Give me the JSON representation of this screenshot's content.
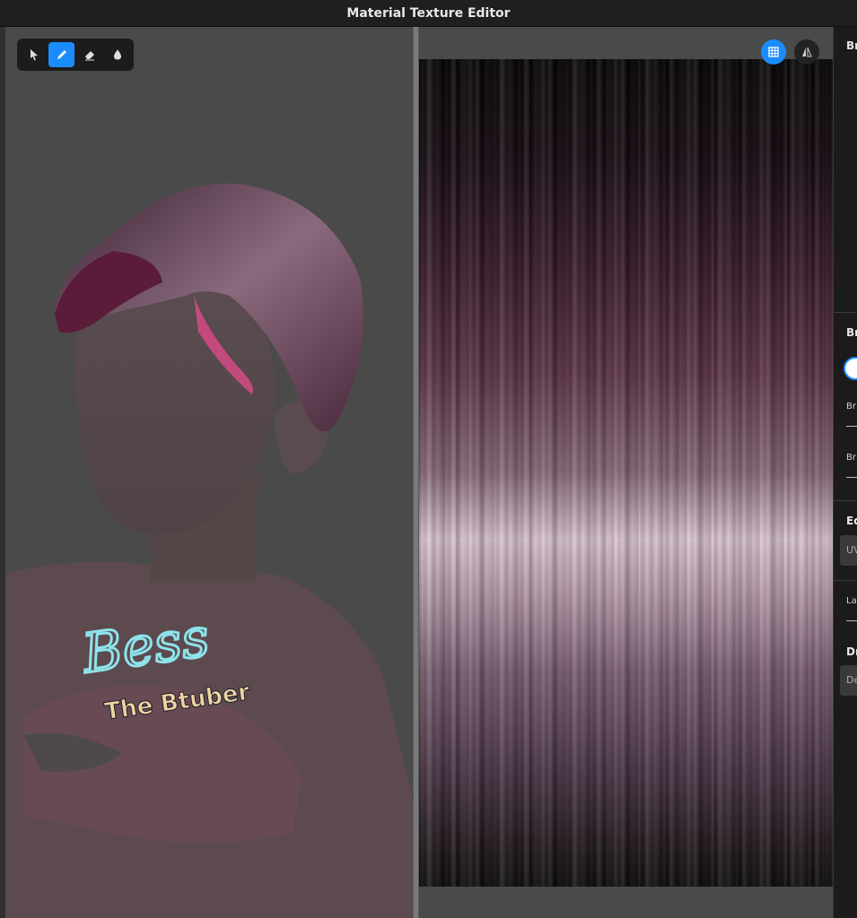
{
  "window": {
    "title": "Material Texture Editor"
  },
  "toolbar": {
    "tools": [
      {
        "name": "select",
        "icon": "cursor-arrow-icon",
        "active": false
      },
      {
        "name": "brush",
        "icon": "pencil-icon",
        "active": true
      },
      {
        "name": "eraser",
        "icon": "eraser-icon",
        "active": false
      },
      {
        "name": "fill",
        "icon": "drop-icon",
        "active": false
      }
    ]
  },
  "viewport": {
    "decal_text_main": "Bess",
    "decal_text_sub": "The Btuber"
  },
  "texture_pane": {
    "buttons": [
      {
        "icon": "grid-icon",
        "active": true
      },
      {
        "icon": "mirror-symmetry-icon",
        "active": false
      }
    ]
  },
  "sidebar": {
    "section_brush_header": "Br",
    "section_brush_props_header": "Br",
    "brush_label_1": "Br",
    "brush_label_2": "Br",
    "section_edit_header": "Ed",
    "uv_select_value": "UV",
    "layer_label": "La",
    "section_draw_header": "Dr",
    "draw_select_value": "De"
  },
  "colors": {
    "accent": "#1a8cff",
    "panel": "#1b1b1b",
    "viewport_bg": "#4a4a4a"
  }
}
